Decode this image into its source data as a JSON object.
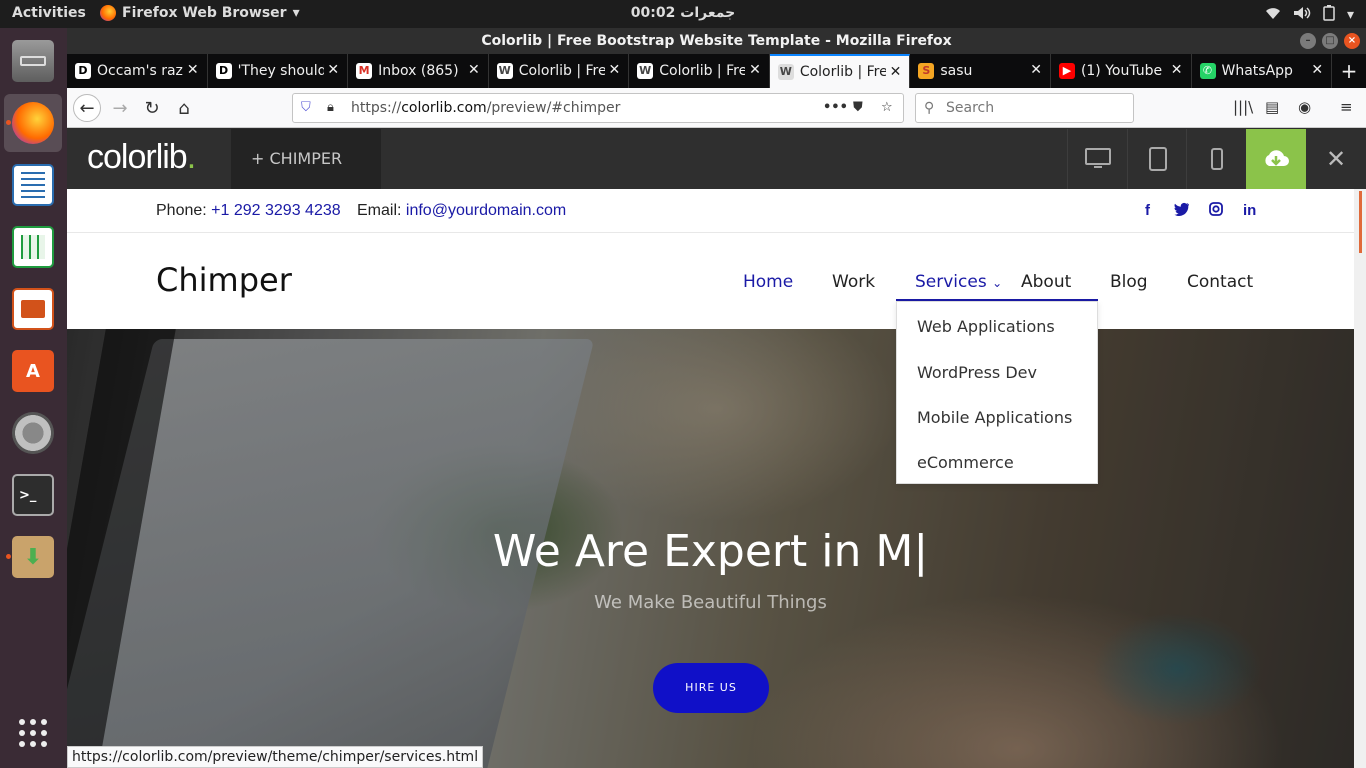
{
  "topbar": {
    "activities": "Activities",
    "app_name": "Firefox Web Browser",
    "clock": "جمعرات 00:02"
  },
  "window": {
    "title": "Colorlib | Free Bootstrap Website Template - Mozilla Firefox"
  },
  "tabs": [
    {
      "label": "Occam's razor",
      "fav": "D",
      "fav_color": "#ffffff",
      "fav_text": "#000000"
    },
    {
      "label": "'They should",
      "fav": "D",
      "fav_color": "#ffffff",
      "fav_text": "#000000"
    },
    {
      "label": "Inbox (865)",
      "fav": "M",
      "fav_color": "#ffffff",
      "fav_text": "#d93025"
    },
    {
      "label": "Colorlib | Free",
      "fav": "W",
      "fav_color": "#ffffff",
      "fav_text": "#464646"
    },
    {
      "label": "Colorlib | Free",
      "fav": "W",
      "fav_color": "#ffffff",
      "fav_text": "#464646"
    },
    {
      "label": "Colorlib | Free",
      "fav": "W",
      "fav_color": "#dddddd",
      "fav_text": "#464646",
      "active": true
    },
    {
      "label": "sasu",
      "fav": "S",
      "fav_color": "#f5a623",
      "fav_text": "#c0392b"
    },
    {
      "label": "(1) YouTube",
      "fav": "▶",
      "fav_color": "#ff0000",
      "fav_text": "#ffffff"
    },
    {
      "label": "WhatsApp",
      "fav": "✆",
      "fav_color": "#25d366",
      "fav_text": "#ffffff"
    }
  ],
  "navbar": {
    "url_prefix": "https://",
    "url_host": "colorlib.com",
    "url_path": "/preview/#chimper",
    "search_placeholder": "Search"
  },
  "colorlib": {
    "logo": "colorlib",
    "logo_dot": ".",
    "theme_label": "+ CHIMPER"
  },
  "site": {
    "phone_label": "Phone:",
    "phone_value": "+1 292 3293 4238",
    "email_label": "Email:",
    "email_value": "info@yourdomain.com",
    "social": [
      "f",
      "t",
      "ig",
      "in"
    ],
    "brand": "Chimper",
    "nav": [
      "Home",
      "Work",
      "Services",
      "About",
      "Blog",
      "Contact"
    ],
    "services_caret": "⌄",
    "dropdown": [
      "Web Applications",
      "WordPress Dev",
      "Mobile Applications",
      "eCommerce"
    ],
    "hero_title": "We Are Expert in M|",
    "hero_subtitle": "We Make Beautiful Things",
    "hire_button": "HIRE US"
  },
  "status_url": "https://colorlib.com/preview/theme/chimper/services.html",
  "colors": {
    "accent": "#1a1aa6",
    "colorlib_green": "#8bc34a",
    "ubuntu_orange": "#e95420"
  }
}
